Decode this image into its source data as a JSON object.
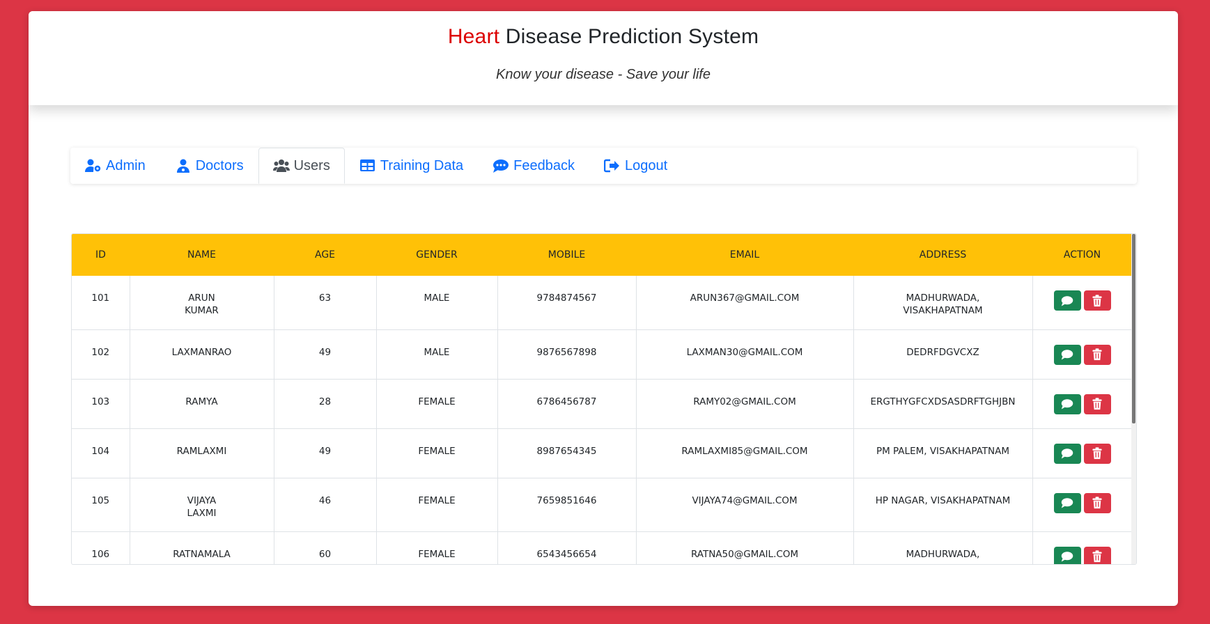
{
  "header": {
    "title_accent": "Heart",
    "title_rest": " Disease Prediction System",
    "subtitle": "Know your disease - Save your life"
  },
  "nav": {
    "tabs": [
      {
        "label": "Admin",
        "icon": "user-gear-icon"
      },
      {
        "label": "Doctors",
        "icon": "doctor-icon"
      },
      {
        "label": "Users",
        "icon": "users-icon"
      },
      {
        "label": "Training Data",
        "icon": "table-icon"
      },
      {
        "label": "Feedback",
        "icon": "comment-dots-icon"
      },
      {
        "label": "Logout",
        "icon": "sign-out-icon"
      }
    ],
    "active": "Users"
  },
  "table": {
    "columns": [
      "ID",
      "NAME",
      "AGE",
      "GENDER",
      "MOBILE",
      "EMAIL",
      "ADDRESS",
      "ACTION"
    ],
    "rows": [
      {
        "id": "101",
        "name": "ARUN\nKUMAR",
        "age": "63",
        "gender": "MALE",
        "mobile": "9784874567",
        "email": "ARUN367@GMAIL.COM",
        "address": "MADHURWADA,\nVISAKHAPATNAM"
      },
      {
        "id": "102",
        "name": "LAXMANRAO",
        "age": "49",
        "gender": "MALE",
        "mobile": "9876567898",
        "email": "LAXMAN30@GMAIL.COM",
        "address": "DEDRFDGVCXZ"
      },
      {
        "id": "103",
        "name": "RAMYA",
        "age": "28",
        "gender": "FEMALE",
        "mobile": "6786456787",
        "email": "RAMY02@GMAIL.COM",
        "address": "ERGTHYGFCXDSASDRFTGHJBN"
      },
      {
        "id": "104",
        "name": "RAMLAXMI",
        "age": "49",
        "gender": "FEMALE",
        "mobile": "8987654345",
        "email": "RAMLAXMI85@GMAIL.COM",
        "address": "PM PALEM, VISAKHAPATNAM"
      },
      {
        "id": "105",
        "name": "VIJAYA\nLAXMI",
        "age": "46",
        "gender": "FEMALE",
        "mobile": "7659851646",
        "email": "VIJAYA74@GMAIL.COM",
        "address": "HP NAGAR, VISAKHAPATNAM"
      },
      {
        "id": "106",
        "name": "RATNAMALA",
        "age": "60",
        "gender": "FEMALE",
        "mobile": "6543456654",
        "email": "RATNA50@GMAIL.COM",
        "address": "MADHURWADA,"
      }
    ]
  },
  "colors": {
    "background": "#dc3545",
    "accent": "#dc0000",
    "link": "#0d6efd",
    "table_header": "#ffc107",
    "feedback_button": "#198754",
    "delete_button": "#dc3545"
  }
}
